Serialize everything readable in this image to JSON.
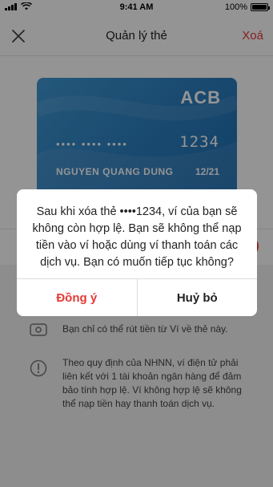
{
  "status_bar": {
    "time": "9:41 AM",
    "battery": "100%",
    "battery_level": 1.0
  },
  "nav": {
    "title": "Quản lý thẻ",
    "action": "Xoá",
    "close_icon": "close-icon"
  },
  "card": {
    "bank": "ACB",
    "masked_number": "•••• •••• ••••",
    "last4": "1234",
    "holder": "NGUYEN QUANG DUNG",
    "expiry": "12/21",
    "color": "#2f82c3"
  },
  "info": [
    {
      "icon": "card-icon",
      "text": "Bạn chỉ có thể rút tiền từ Ví về thẻ này."
    },
    {
      "icon": "warning-icon",
      "text": "Theo quy định của NHNN, ví điện tử phải liên kết với 1 tài khoản ngân hàng để đảm bảo tính hợp lệ. Ví không hợp lệ sẽ không thể nạp tiền hay thanh toán dịch vụ."
    }
  ],
  "dialog": {
    "message": "Sau khi xóa thẻ ••••1234, ví của bạn sẽ không còn hợp lệ. Bạn sẽ không thể nạp tiền vào ví hoặc dùng ví thanh toán các dịch vụ. Bạn có muốn tiếp tục không?",
    "confirm": "Đồng ý",
    "cancel": "Huỷ bỏ"
  },
  "colors": {
    "accent": "#e53935",
    "overlay": "rgba(0,0,0,0.42)"
  }
}
